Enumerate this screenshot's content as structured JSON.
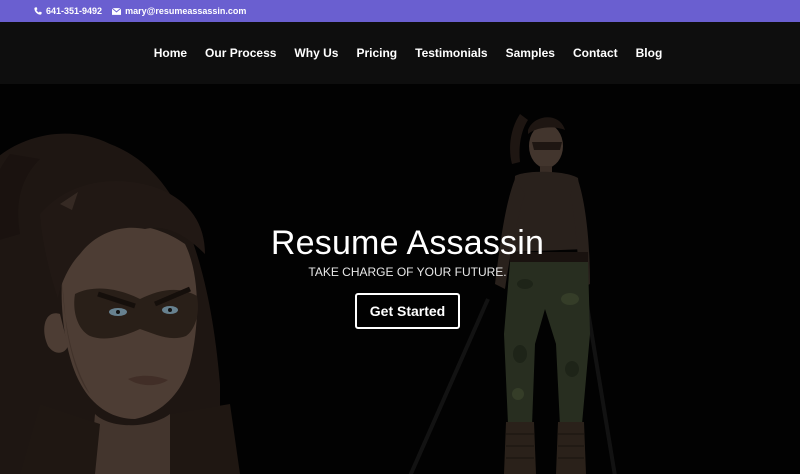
{
  "topbar": {
    "phone": "641-351-9492",
    "email": "mary@resumeassassin.com",
    "phone_icon": "phone-icon",
    "email_icon": "envelope-icon",
    "background": "#6a5fd0"
  },
  "nav": {
    "items": [
      {
        "label": "Home"
      },
      {
        "label": "Our Process"
      },
      {
        "label": "Why Us"
      },
      {
        "label": "Pricing"
      },
      {
        "label": "Testimonials"
      },
      {
        "label": "Samples"
      },
      {
        "label": "Contact"
      },
      {
        "label": "Blog"
      }
    ]
  },
  "hero": {
    "title": "Resume Assassin",
    "subtitle": "TAKE CHARGE OF YOUR FUTURE.",
    "cta_label": "Get Started"
  }
}
